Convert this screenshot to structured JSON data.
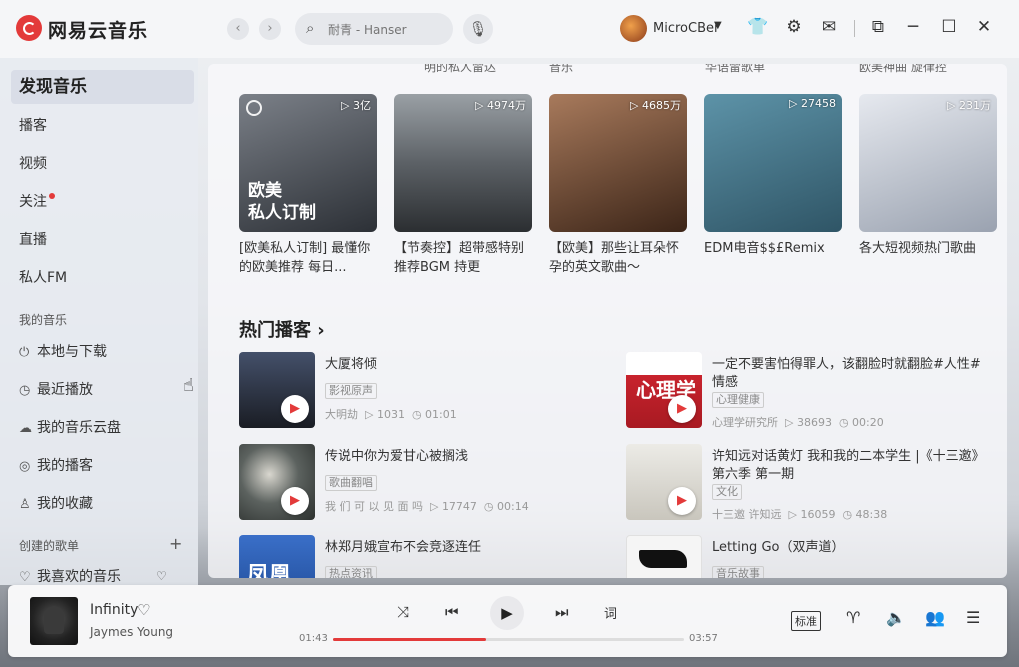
{
  "app": {
    "title": "网易云音乐"
  },
  "header": {
    "back": "‹",
    "forward": "›",
    "search_placeholder": "耐青 - Hanser",
    "user_name": "MicroCBer"
  },
  "sidebar": {
    "main_items": [
      {
        "label": "发现音乐"
      },
      {
        "label": "播客"
      },
      {
        "label": "视频"
      },
      {
        "label": "关注"
      },
      {
        "label": "直播"
      },
      {
        "label": "私人FM"
      }
    ],
    "my_music_title": "我的音乐",
    "my_music_items": [
      {
        "label": "本地与下载",
        "icon": "download-icon"
      },
      {
        "label": "最近播放",
        "icon": "clock-icon"
      },
      {
        "label": "我的音乐云盘",
        "icon": "cloud-icon"
      },
      {
        "label": "我的播客",
        "icon": "podcast-icon"
      },
      {
        "label": "我的收藏",
        "icon": "collect-icon"
      }
    ],
    "created_title": "创建的歌单",
    "liked_label": "我喜欢的音乐"
  },
  "playlists_top_cut": [
    "明的私人雷达",
    "音乐",
    "华语雷歌单",
    "欧美神曲 旋律控"
  ],
  "playlists": [
    {
      "count": "3亿",
      "title": "[欧美私人订制] 最懂你的欧美推荐 每日...",
      "cover_text": "欧美\n私人订制",
      "color": "#3b3f45"
    },
    {
      "count": "4974万",
      "title": "【节奏控】超带感特别推荐BGM 持更",
      "cover_text": "",
      "color": "#6d7176"
    },
    {
      "count": "4685万",
      "title": "【欧美】那些让耳朵怀孕的英文歌曲～",
      "cover_text": "",
      "color": "#4a3527"
    },
    {
      "count": "27458",
      "title": "EDM电音$$£Remix",
      "cover_text": "",
      "color": "#4c7f96"
    },
    {
      "count": "231万",
      "title": "各大短视频热门歌曲",
      "cover_text": "",
      "color": "#c9ced8"
    }
  ],
  "podcasts_title": "热门播客 ›",
  "podcasts": [
    {
      "title": "大厦将倾",
      "tag": "影视原声",
      "author": "大明劫",
      "plays": "1031",
      "duration": "01:01",
      "color": "#2a2f3a"
    },
    {
      "title": "一定不要害怕得罪人，该翻脸时就翻脸#人性#情感",
      "tag": "心理健康",
      "author": "心理学研究所",
      "plays": "38693",
      "duration": "00:20",
      "color": "#c8232d",
      "cover_text": "心理学"
    },
    {
      "title": "传说中你为爱甘心被搁浅",
      "tag": "歌曲翻唱",
      "author": "我 们 可 以 见 面 吗",
      "plays": "17747",
      "duration": "00:14",
      "color": "#3a3f3c"
    },
    {
      "title": "许知远对话黄灯 我和我的二本学生 |《十三邀》第六季 第一期",
      "tag": "文化",
      "author": "十三邀 许知远",
      "plays": "16059",
      "duration": "48:38",
      "color": "#e4e2dc"
    },
    {
      "title": "林郑月娥宣布不会竞逐连任",
      "tag": "热点资讯",
      "author": "",
      "plays": "",
      "duration": "",
      "color": "#2f5fb3",
      "cover_text": "凤凰"
    },
    {
      "title": "Letting Go（双声道）",
      "tag": "音乐故事",
      "author": "",
      "plays": "",
      "duration": "",
      "color": "#f4f4f4"
    }
  ],
  "player": {
    "song": "Infinity",
    "artist": "Jaymes Young",
    "current_time": "01:43",
    "total_time": "03:57",
    "progress": 0.435,
    "lyrics_label": "词",
    "quality": "标准"
  },
  "colors": {
    "accent": "#e33a3a"
  }
}
